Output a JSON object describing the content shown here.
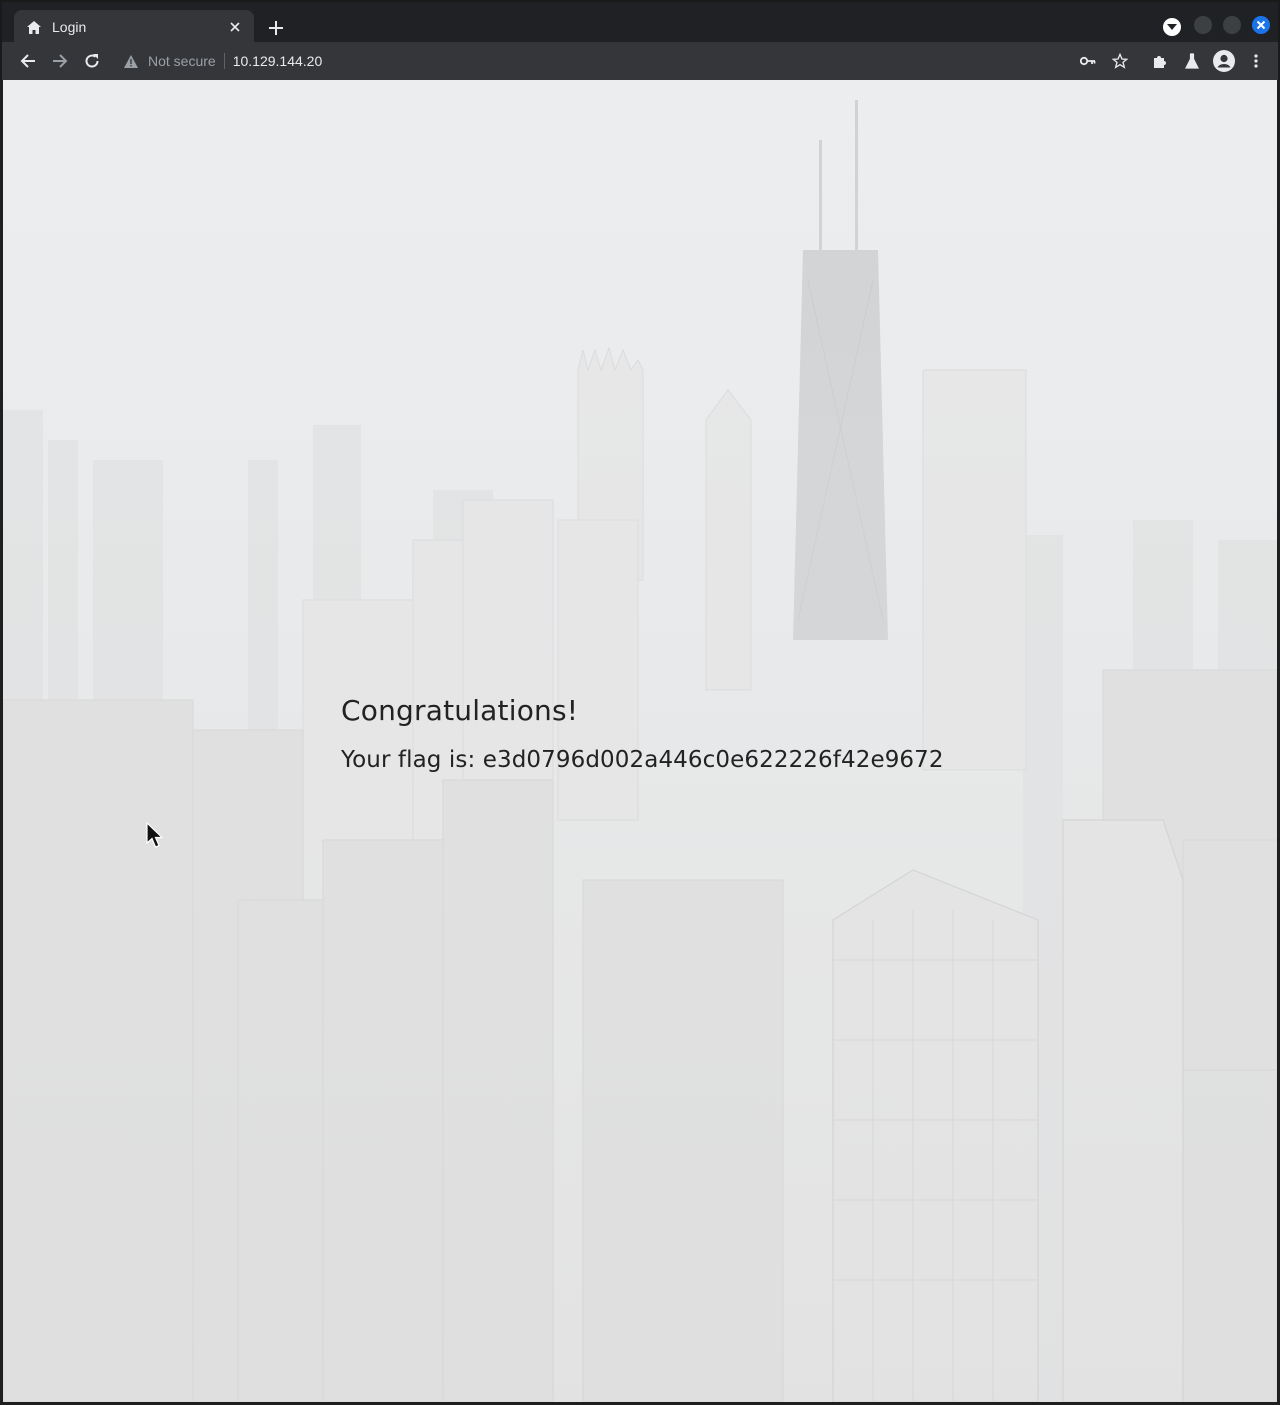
{
  "browser": {
    "tab_title": "Login",
    "security_label": "Not secure",
    "url": "10.129.144.20"
  },
  "page": {
    "heading": "Congratulations!",
    "flag_message": "Your flag is: e3d0796d002a446c0e622226f42e9672"
  },
  "icons": {
    "tab_favicon": "home-icon",
    "tab_close": "close-icon",
    "new_tab": "plus-icon",
    "back": "arrow-left-icon",
    "forward": "arrow-right-icon",
    "reload": "reload-icon",
    "security": "warning-icon",
    "password": "key-icon",
    "bookmark": "star-icon",
    "extensions": "puzzle-icon",
    "labs": "flask-icon",
    "profile": "avatar-icon",
    "menu": "kebab-menu-icon"
  },
  "colors": {
    "chrome_dark": "#202124",
    "toolbar": "#35363a",
    "close_button": "#1a73e8",
    "page_text": "#222222"
  }
}
